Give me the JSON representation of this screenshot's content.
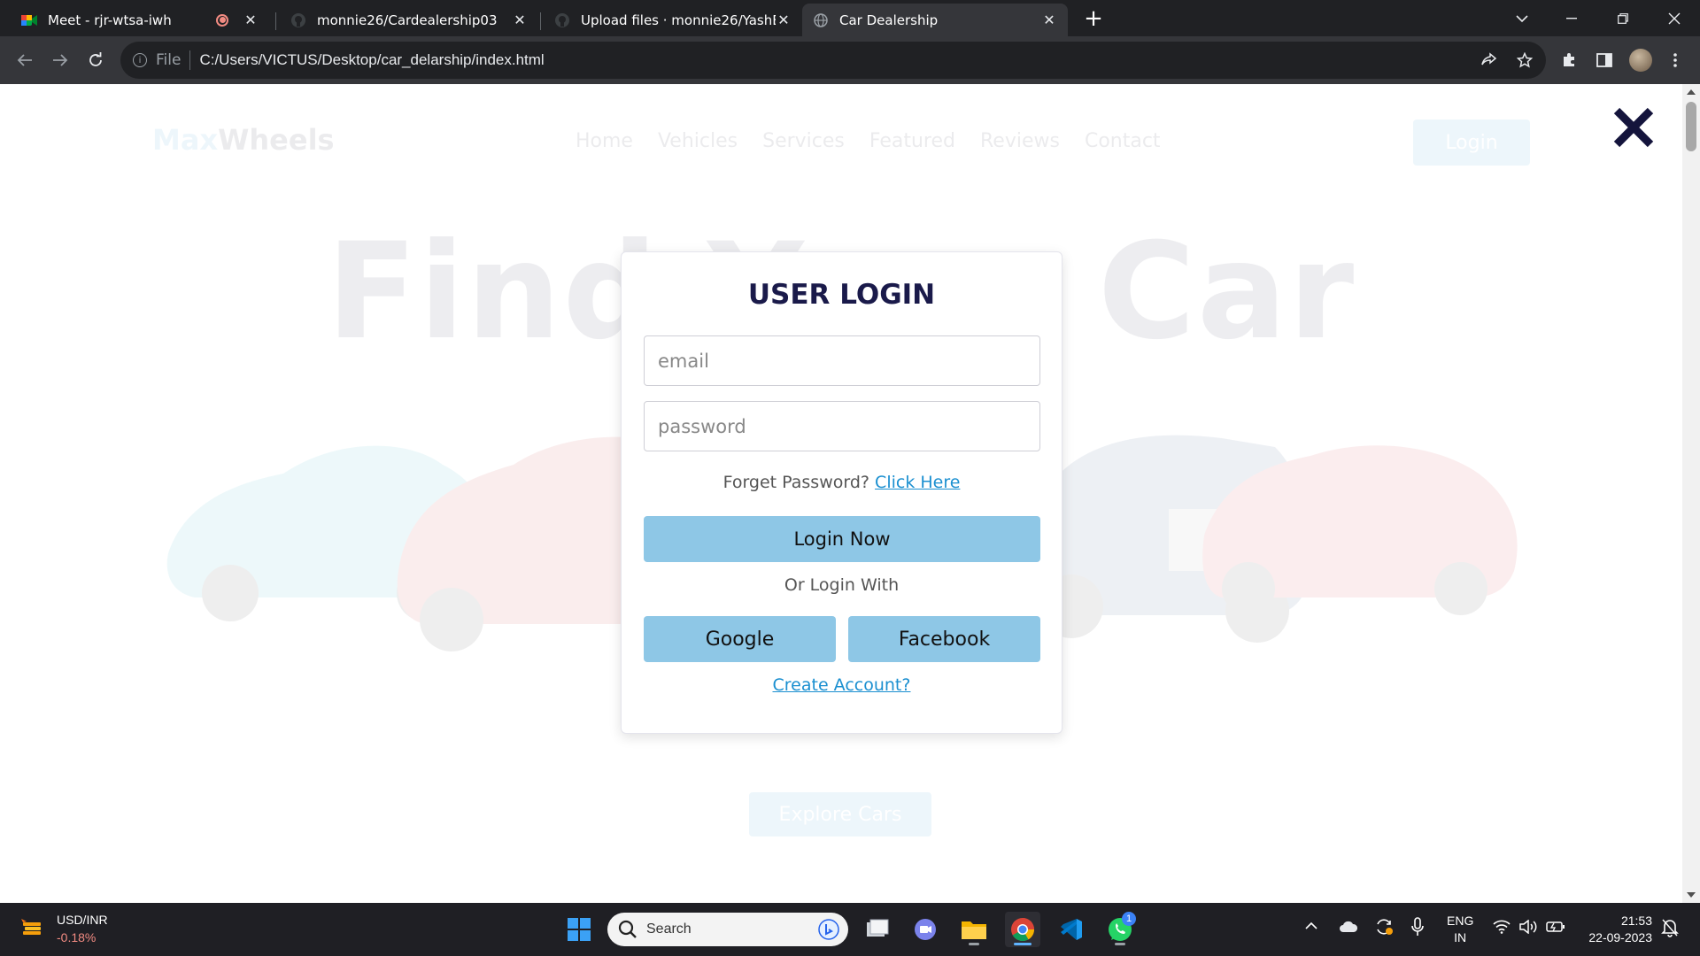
{
  "browser": {
    "tabs": [
      {
        "title": "Meet - rjr-wtsa-iwh",
        "recording": true
      },
      {
        "title": "monnie26/Cardealership03"
      },
      {
        "title": "Upload files · monnie26/YashBec"
      },
      {
        "title": "Car Dealership"
      }
    ],
    "address": {
      "scheme_label": "File",
      "url": "C:/Users/VICTUS/Desktop/car_delarship/index.html"
    }
  },
  "site": {
    "logo_prefix": "Max",
    "logo_suffix": "Wheels",
    "nav": [
      "Home",
      "Vehicles",
      "Services",
      "Featured",
      "Reviews",
      "Contact"
    ],
    "login_button": "Login",
    "hero_title": "Find Your Car",
    "explore_button": "Explore Cars"
  },
  "login": {
    "title": "USER LOGIN",
    "email_placeholder": "email",
    "password_placeholder": "password",
    "forget_text": "Forget Password?",
    "forget_link": "Click Here",
    "submit": "Login Now",
    "or_text": "Or Login With",
    "google": "Google",
    "facebook": "Facebook",
    "create_account": "Create Account?"
  },
  "taskbar": {
    "widget_label": "USD/INR",
    "widget_change": "-0.18%",
    "search_placeholder": "Search",
    "whatsapp_badge": "1",
    "lang_line1": "ENG",
    "lang_line2": "IN",
    "time": "21:53",
    "date": "22-09-2023"
  },
  "colors": {
    "accent": "#2a93d5",
    "button_fill": "#8ec7e6",
    "title": "#1a1a4a",
    "link": "#1a8fd0"
  }
}
